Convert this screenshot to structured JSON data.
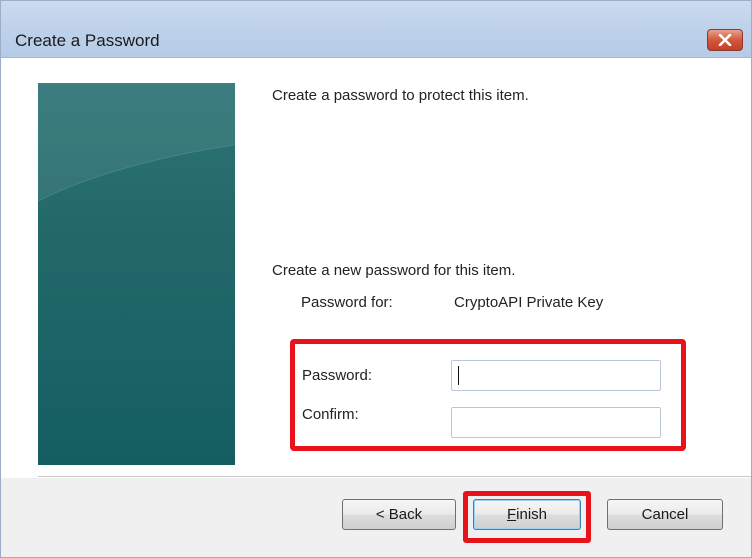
{
  "window": {
    "title": "Create a Password",
    "close_icon": "close-icon"
  },
  "main": {
    "intro": "Create a password to protect this item.",
    "new_password_prompt": "Create a new password for this item.",
    "password_for_label": "Password for:",
    "password_for_value": "CryptoAPI Private Key",
    "password_label": "Password:",
    "password_value": "",
    "confirm_label": "Confirm:",
    "confirm_value": ""
  },
  "footer": {
    "back_label": "< Back",
    "finish_label_accel": "F",
    "finish_label_rest": "inish",
    "cancel_label": "Cancel"
  },
  "colors": {
    "highlight": "#e8121b",
    "side_panel": "#236869",
    "close_button": "#c2412a"
  }
}
